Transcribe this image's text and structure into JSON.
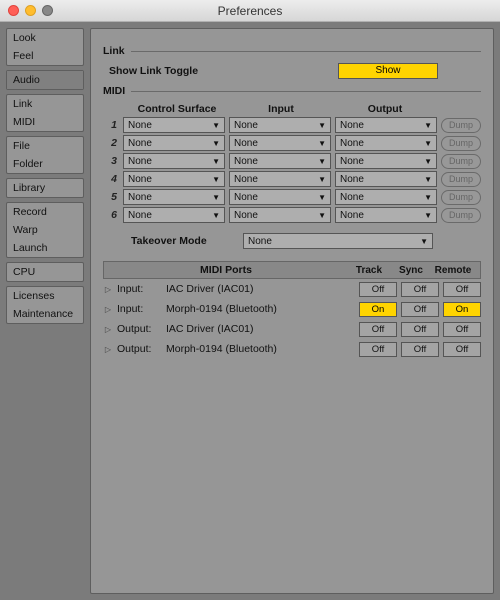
{
  "window": {
    "title": "Preferences"
  },
  "sidebar": {
    "groups": [
      {
        "items": [
          {
            "label": "Look",
            "id": "look"
          },
          {
            "label": "Feel",
            "id": "feel"
          }
        ]
      },
      {
        "items": [
          {
            "label": "Audio",
            "id": "audio",
            "active": true
          }
        ]
      },
      {
        "items": [
          {
            "label": "Link",
            "id": "link"
          },
          {
            "label": "MIDI",
            "id": "midi"
          }
        ]
      },
      {
        "items": [
          {
            "label": "File",
            "id": "file"
          },
          {
            "label": "Folder",
            "id": "folder"
          }
        ]
      },
      {
        "items": [
          {
            "label": "Library",
            "id": "library"
          }
        ]
      },
      {
        "items": [
          {
            "label": "Record",
            "id": "record"
          },
          {
            "label": "Warp",
            "id": "warp"
          },
          {
            "label": "Launch",
            "id": "launch"
          }
        ]
      },
      {
        "items": [
          {
            "label": "CPU",
            "id": "cpu"
          }
        ]
      },
      {
        "items": [
          {
            "label": "Licenses",
            "id": "licenses"
          },
          {
            "label": "Maintenance",
            "id": "maintenance"
          }
        ]
      }
    ]
  },
  "sections": {
    "link": {
      "title": "Link",
      "show_toggle_label": "Show Link Toggle",
      "show_button": "Show"
    },
    "midi": {
      "title": "MIDI",
      "columns": {
        "surface": "Control Surface",
        "input": "Input",
        "output": "Output"
      },
      "dump_label": "Dump",
      "none_label": "None",
      "slots": [
        {
          "n": "1",
          "surface": "None",
          "input": "None",
          "output": "None"
        },
        {
          "n": "2",
          "surface": "None",
          "input": "None",
          "output": "None"
        },
        {
          "n": "3",
          "surface": "None",
          "input": "None",
          "output": "None"
        },
        {
          "n": "4",
          "surface": "None",
          "input": "None",
          "output": "None"
        },
        {
          "n": "5",
          "surface": "None",
          "input": "None",
          "output": "None"
        },
        {
          "n": "6",
          "surface": "None",
          "input": "None",
          "output": "None"
        }
      ],
      "takeover": {
        "label": "Takeover Mode",
        "value": "None"
      },
      "ports": {
        "header": {
          "title": "MIDI Ports",
          "track": "Track",
          "sync": "Sync",
          "remote": "Remote"
        },
        "on": "On",
        "off": "Off",
        "rows": [
          {
            "dir": "Input:",
            "name": "IAC Driver (IAC01)",
            "track": "Off",
            "sync": "Off",
            "remote": "Off"
          },
          {
            "dir": "Input:",
            "name": "Morph-0194 (Bluetooth)",
            "track": "On",
            "sync": "Off",
            "remote": "On"
          },
          {
            "dir": "Output:",
            "name": "IAC Driver (IAC01)",
            "track": "Off",
            "sync": "Off",
            "remote": "Off"
          },
          {
            "dir": "Output:",
            "name": "Morph-0194 (Bluetooth)",
            "track": "Off",
            "sync": "Off",
            "remote": "Off"
          }
        ]
      }
    }
  }
}
